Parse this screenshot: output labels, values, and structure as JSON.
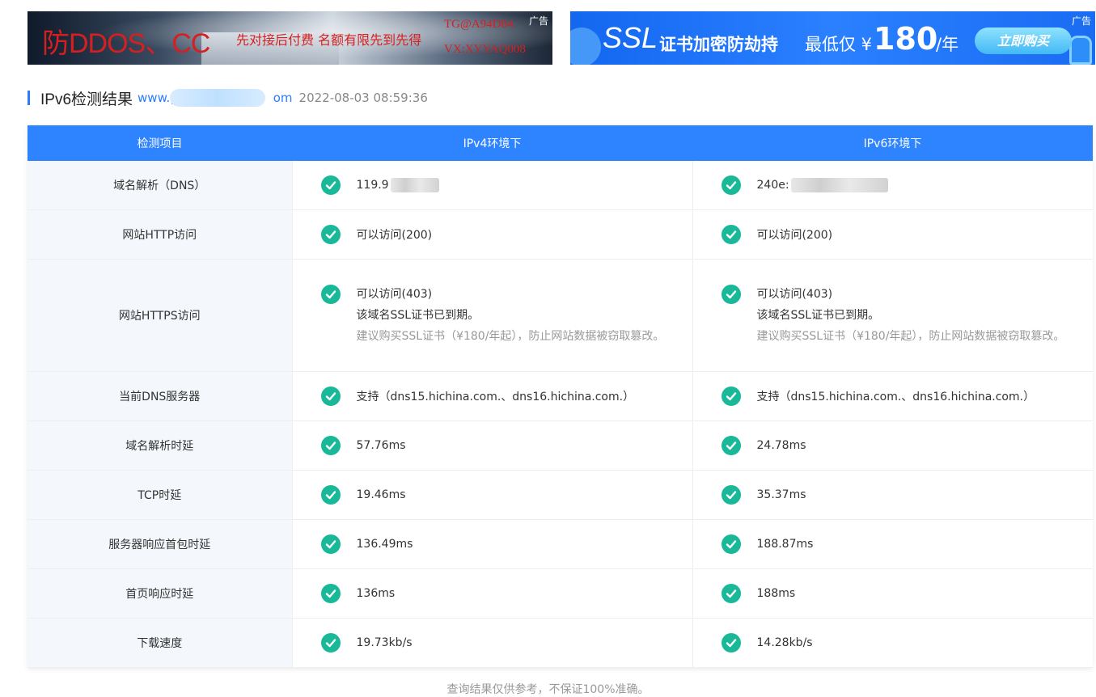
{
  "ads": {
    "left": {
      "tag": "广告",
      "headline": "防DDOS、CC",
      "subline": "先对接后付费 名额有限先到先得",
      "tg": "TG@A94D84",
      "vx": "VX:XYYAQ008"
    },
    "right": {
      "tag": "广告",
      "ssl": "SSL",
      "text1": "证书加密防劫持",
      "text2": "最低仅 ¥",
      "price": "180",
      "unit": "/年",
      "button": "立即购买"
    }
  },
  "header": {
    "title": "IPv6检测结果",
    "domain_prefix": "www.g",
    "domain_suffix": "om",
    "time": "2022-08-03 08:59:36"
  },
  "table": {
    "columns": [
      "检测项目",
      "IPv4环境下",
      "IPv6环境下"
    ],
    "rows": [
      {
        "item": "域名解析（DNS）",
        "ipv4": [
          "119.9"
        ],
        "ipv6": [
          "240e:"
        ]
      },
      {
        "item": "网站HTTP访问",
        "ipv4": [
          "可以访问(200)"
        ],
        "ipv6": [
          "可以访问(200)"
        ]
      },
      {
        "item": "网站HTTPS访问",
        "ipv4": [
          "可以访问(403)",
          "该域名SSL证书已到期。",
          "建议购买SSL证书（¥180/年起），防止网站数据被窃取篡改。"
        ],
        "ipv6": [
          "可以访问(403)",
          "该域名SSL证书已到期。",
          "建议购买SSL证书（¥180/年起），防止网站数据被窃取篡改。"
        ]
      },
      {
        "item": "当前DNS服务器",
        "ipv4": [
          "支持（dns15.hichina.com.、dns16.hichina.com.）"
        ],
        "ipv6": [
          "支持（dns15.hichina.com.、dns16.hichina.com.）"
        ]
      },
      {
        "item": "域名解析时延",
        "ipv4": [
          "57.76ms"
        ],
        "ipv6": [
          "24.78ms"
        ]
      },
      {
        "item": "TCP时延",
        "ipv4": [
          "19.46ms"
        ],
        "ipv6": [
          "35.37ms"
        ]
      },
      {
        "item": "服务器响应首包时延",
        "ipv4": [
          "136.49ms"
        ],
        "ipv6": [
          "188.87ms"
        ]
      },
      {
        "item": "首页响应时延",
        "ipv4": [
          "136ms"
        ],
        "ipv6": [
          "188ms"
        ]
      },
      {
        "item": "下载速度",
        "ipv4": [
          "19.73kb/s"
        ],
        "ipv6": [
          "14.28kb/s"
        ]
      }
    ]
  },
  "footer": {
    "note": "查询结果仅供参考，不保证100%准确。"
  },
  "colors": {
    "accent": "#2e83ff",
    "check": "#19b899",
    "row_label_bg": "#f4f8fc"
  },
  "icons": {
    "status": "check-circle-icon"
  }
}
